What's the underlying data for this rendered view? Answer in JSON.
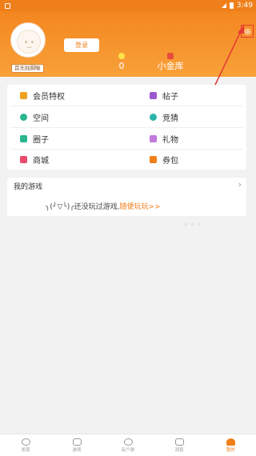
{
  "status_bar": {
    "time": "3:49"
  },
  "profile": {
    "avatar_tag": "首无独脚喔",
    "login_label": "登录",
    "coins_value": "0",
    "vault_label": "小金库"
  },
  "menu": {
    "items": [
      {
        "label": "会员特权",
        "icon": "crown-icon",
        "color": "#f0a020"
      },
      {
        "label": "帖子",
        "icon": "post-icon",
        "color": "#9b59d0"
      },
      {
        "label": "空间",
        "icon": "space-icon",
        "color": "#2bb58c"
      },
      {
        "label": "竞猜",
        "icon": "star-icon",
        "color": "#2bb5a8"
      },
      {
        "label": "圈子",
        "icon": "circle-icon",
        "color": "#2bb58c"
      },
      {
        "label": "礼物",
        "icon": "gift-icon",
        "color": "#c07ad9"
      },
      {
        "label": "商城",
        "icon": "shop-icon",
        "color": "#e94b6a"
      },
      {
        "label": "券包",
        "icon": "coupon-icon",
        "color": "#ef7f1a"
      }
    ]
  },
  "games": {
    "title": "我的游戏",
    "empty_text": "╮(╯▽╰)╭还没玩过游戏,",
    "empty_link": "随便玩玩>>"
  },
  "tabs": [
    {
      "label": "发现",
      "icon": "eye-icon"
    },
    {
      "label": "游戏",
      "icon": "gamepad-icon"
    },
    {
      "label": "玩个游",
      "icon": "planet-icon"
    },
    {
      "label": "消息",
      "icon": "chat-icon"
    },
    {
      "label": "我的",
      "icon": "person-icon",
      "active": true
    }
  ],
  "colors": {
    "accent": "#ef7f1a",
    "highlight": "#e53935"
  }
}
